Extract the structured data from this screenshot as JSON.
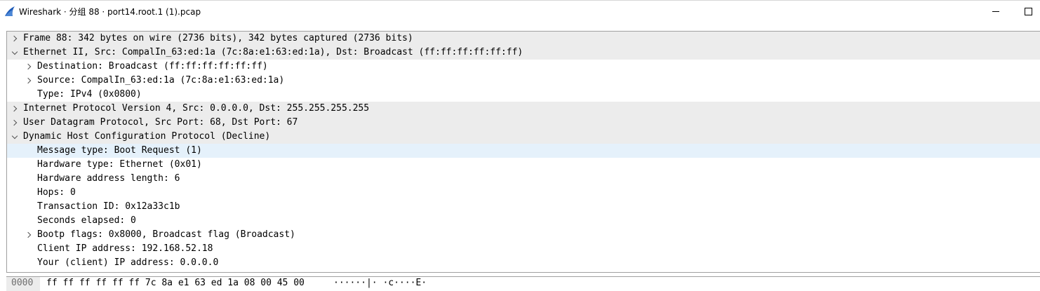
{
  "window": {
    "title": "Wireshark · 分组 88 · port14.root.1 (1).pcap",
    "accent_color": "#1e5bb8"
  },
  "tree": {
    "rows": [
      {
        "text": "Frame 88: 342 bytes on wire (2736 bits), 342 bytes captured (2736 bits)",
        "expander": "collapsed"
      },
      {
        "text": "Ethernet II, Src: CompalIn_63:ed:1a (7c:8a:e1:63:ed:1a), Dst: Broadcast (ff:ff:ff:ff:ff:ff)",
        "expander": "expanded"
      },
      {
        "text": "Destination: Broadcast (ff:ff:ff:ff:ff:ff)",
        "expander": "collapsed"
      },
      {
        "text": "Source: CompalIn_63:ed:1a (7c:8a:e1:63:ed:1a)",
        "expander": "collapsed"
      },
      {
        "text": "Type: IPv4 (0x0800)",
        "expander": "none"
      },
      {
        "text": "Internet Protocol Version 4, Src: 0.0.0.0, Dst: 255.255.255.255",
        "expander": "collapsed"
      },
      {
        "text": "User Datagram Protocol, Src Port: 68, Dst Port: 67",
        "expander": "collapsed"
      },
      {
        "text": "Dynamic Host Configuration Protocol (Decline)",
        "expander": "expanded"
      },
      {
        "text": "Message type: Boot Request (1)",
        "expander": "none",
        "selected": true
      },
      {
        "text": "Hardware type: Ethernet (0x01)",
        "expander": "none"
      },
      {
        "text": "Hardware address length: 6",
        "expander": "none"
      },
      {
        "text": "Hops: 0",
        "expander": "none"
      },
      {
        "text": "Transaction ID: 0x12a33c1b",
        "expander": "none"
      },
      {
        "text": "Seconds elapsed: 0",
        "expander": "none"
      },
      {
        "text": "Bootp flags: 0x8000, Broadcast flag (Broadcast)",
        "expander": "collapsed"
      },
      {
        "text": "Client IP address: 192.168.52.18",
        "expander": "none"
      },
      {
        "text": "Your (client) IP address: 0.0.0.0",
        "expander": "none"
      }
    ]
  },
  "hex": {
    "offset": "0000",
    "bytes": "ff ff ff ff ff ff 7c 8a  e1 63 ed 1a 08 00 45 00",
    "ascii": "······|· ·c····E·"
  }
}
